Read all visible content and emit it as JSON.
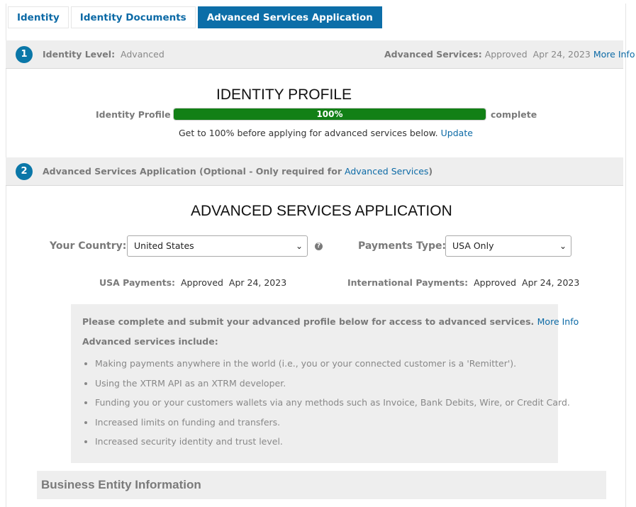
{
  "tabs": [
    "Identity",
    "Identity Documents",
    "Advanced Services Application"
  ],
  "step1": {
    "number": "1",
    "level_label": "Identity Level:",
    "level_value": "Advanced",
    "services_label": "Advanced Services:",
    "services_status": "Approved",
    "services_date": "Apr 24, 2023",
    "more_info": "More Info"
  },
  "identity_profile": {
    "title": "IDENTITY PROFILE",
    "label": "Identity Profile",
    "progress_text": "100%",
    "progress_value": 1.0,
    "suffix": "complete",
    "hint": "Get to 100% before applying for advanced services below.",
    "update_link": "Update"
  },
  "step2": {
    "number": "2",
    "text": "Advanced Services Application (Optional - Only required for",
    "link": "Advanced Services",
    "close": ")"
  },
  "application": {
    "title": "ADVANCED SERVICES APPLICATION",
    "country_label": "Your Country:",
    "country_value": "United States",
    "payments_type_label": "Payments Type:",
    "payments_type_value": "USA Only",
    "usa_label": "USA Payments:",
    "usa_status": "Approved",
    "usa_date": "Apr 24, 2023",
    "intl_label": "International Payments:",
    "intl_status": "Approved",
    "intl_date": "Apr 24, 2023"
  },
  "infobox": {
    "lead": "Please complete and submit your advanced profile below for access to advanced services.",
    "more_info": "More Info",
    "sub": "Advanced services include:",
    "items": [
      "Making payments anywhere in the world (i.e., you or your connected customer is a 'Remitter').",
      "Using the XTRM API as an XTRM developer.",
      "Funding you or your customers wallets via any methods such as Invoice, Bank Debits, Wire, or Credit Card.",
      "Increased limits on funding and transfers.",
      "Increased security identity and trust level."
    ]
  },
  "business_section": {
    "title": "Business Entity Information"
  },
  "colors": {
    "accent": "#0c6ea8",
    "progress": "#128016",
    "panel": "#eeeeee"
  }
}
